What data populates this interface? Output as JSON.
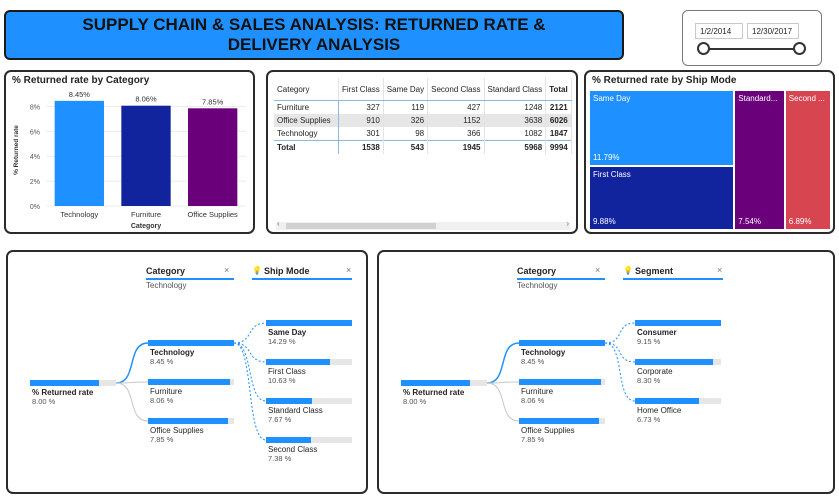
{
  "header": {
    "title": "SUPPLY CHAIN & SALES ANALYSIS: RETURNED RATE & DELIVERY ANALYSIS"
  },
  "date_slicer": {
    "start": "1/2/2014",
    "end": "12/30/2017"
  },
  "chart_data": [
    {
      "type": "bar",
      "title": "% Returned rate by Category",
      "xlabel": "Category",
      "ylabel": "% Returned rate",
      "categories": [
        "Technology",
        "Furniture",
        "Office Supplies"
      ],
      "values": [
        8.45,
        8.06,
        7.85
      ],
      "data_labels": [
        "8.45%",
        "8.06%",
        "7.85%"
      ],
      "bar_colors": [
        "#1e90ff",
        "#12239e",
        "#6b007b"
      ],
      "ylim": [
        0,
        9
      ],
      "yticks": [
        "0%",
        "2%",
        "4%",
        "6%",
        "8%"
      ],
      "ytick_values": [
        0,
        2,
        4,
        6,
        8
      ],
      "grid": true
    },
    {
      "type": "table",
      "columns": [
        "Category",
        "First Class",
        "Same Day",
        "Second Class",
        "Standard Class",
        "Total"
      ],
      "rows": [
        [
          "Furniture",
          "327",
          "119",
          "427",
          "1248",
          "2121"
        ],
        [
          "Office Supplies",
          "910",
          "326",
          "1152",
          "3638",
          "6026"
        ],
        [
          "Technology",
          "301",
          "98",
          "366",
          "1082",
          "1847"
        ],
        [
          "Total",
          "1538",
          "543",
          "1945",
          "5968",
          "9994"
        ]
      ]
    },
    {
      "type": "heatmap",
      "subtype": "treemap",
      "title": "% Returned rate by Ship Mode",
      "items": [
        {
          "label": "Same Day",
          "value": 11.79,
          "display": "11.79%",
          "color": "#1e90ff"
        },
        {
          "label": "First Class",
          "value": 9.88,
          "display": "9.88%",
          "color": "#12239e"
        },
        {
          "label": "Standard...",
          "value": 7.54,
          "display": "7.54%",
          "color": "#6b007b"
        },
        {
          "label": "Second ...",
          "value": 6.89,
          "display": "6.89%",
          "color": "#d64550"
        }
      ]
    }
  ],
  "tree1": {
    "level1": {
      "title": "Category",
      "sub": "Technology",
      "close": "×"
    },
    "level2": {
      "title": "Ship Mode",
      "close": "×"
    },
    "root": {
      "label": "% Returned rate",
      "value": "8.00 %",
      "fill": 0.8
    },
    "mid": [
      {
        "label": "Technology",
        "value": "8.45 %",
        "fill": 1.0
      },
      {
        "label": "Furniture",
        "value": "8.06 %",
        "fill": 0.95
      },
      {
        "label": "Office Supplies",
        "value": "7.85 %",
        "fill": 0.93
      }
    ],
    "leaf": [
      {
        "label": "Same Day",
        "value": "14.29 %",
        "fill": 1.0
      },
      {
        "label": "First Class",
        "value": "10.63 %",
        "fill": 0.74
      },
      {
        "label": "Standard Class",
        "value": "7.67 %",
        "fill": 0.54
      },
      {
        "label": "Second Class",
        "value": "7.38 %",
        "fill": 0.52
      }
    ]
  },
  "tree2": {
    "level1": {
      "title": "Category",
      "sub": "Technology",
      "close": "×"
    },
    "level2": {
      "title": "Segment",
      "close": "×"
    },
    "root": {
      "label": "% Returned rate",
      "value": "8.00 %",
      "fill": 0.8
    },
    "mid": [
      {
        "label": "Technology",
        "value": "8.45 %",
        "fill": 1.0
      },
      {
        "label": "Furniture",
        "value": "8.06 %",
        "fill": 0.95
      },
      {
        "label": "Office Supplies",
        "value": "7.85 %",
        "fill": 0.93
      }
    ],
    "leaf": [
      {
        "label": "Consumer",
        "value": "9.15 %",
        "fill": 1.0
      },
      {
        "label": "Corporate",
        "value": "8.30 %",
        "fill": 0.91
      },
      {
        "label": "Home Office",
        "value": "6.73 %",
        "fill": 0.74
      }
    ]
  },
  "colors": {
    "accent": "#1e90ff",
    "navy": "#12239e",
    "purple": "#6b007b",
    "red": "#d64550"
  },
  "icons": {
    "bulb": "lightbulb-icon",
    "close": "close-icon"
  }
}
